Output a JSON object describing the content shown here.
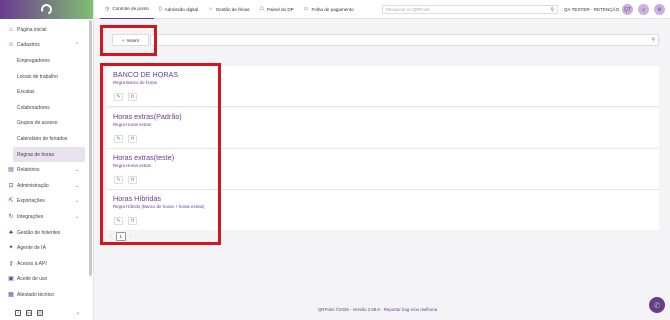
{
  "sidebar": {
    "items": [
      {
        "label": "Página inicial",
        "icon": "home-icon",
        "glyph": "⌂",
        "sub": false,
        "chevron": false
      },
      {
        "label": "Cadastros",
        "icon": "people-icon",
        "glyph": "☺",
        "sub": false,
        "chevron": "up"
      },
      {
        "label": "Empregadores",
        "sub": true
      },
      {
        "label": "Locais de trabalho",
        "sub": true
      },
      {
        "label": "Escalas",
        "sub": true
      },
      {
        "label": "Colaboradores",
        "sub": true
      },
      {
        "label": "Grupos de acesso",
        "sub": true
      },
      {
        "label": "Calendário de feriados",
        "sub": true
      },
      {
        "label": "Regras de horas",
        "sub": true,
        "active": true
      },
      {
        "label": "Relatórios",
        "icon": "file-icon",
        "glyph": "▤",
        "sub": false,
        "chevron": "down"
      },
      {
        "label": "Administração",
        "icon": "lock-icon",
        "glyph": "⊡",
        "sub": false,
        "chevron": "down"
      },
      {
        "label": "Exportações",
        "icon": "export-icon",
        "glyph": "⇱",
        "sub": false,
        "chevron": "down"
      },
      {
        "label": "Integrações",
        "icon": "sync-icon",
        "glyph": "↻",
        "sub": false,
        "chevron": "down"
      },
      {
        "label": "Gestão de holerites",
        "icon": "hierarchy-icon",
        "glyph": "♣",
        "sub": false,
        "chevron": false
      },
      {
        "label": "Agente de IA",
        "icon": "ai-icon",
        "glyph": "✦",
        "sub": false,
        "chevron": false
      },
      {
        "label": "Acesso à API",
        "icon": "key-icon",
        "glyph": "⚷",
        "sub": false,
        "chevron": false
      },
      {
        "label": "Aceite de uso",
        "icon": "document-icon",
        "glyph": "▣",
        "sub": false,
        "chevron": false
      },
      {
        "label": "Atestado técnico",
        "icon": "certificate-icon",
        "glyph": "▦",
        "sub": false,
        "chevron": false
      }
    ],
    "footer_icons": [
      "facebook-icon",
      "linkedin-icon",
      "instagram-icon"
    ],
    "collapse_glyph": "‹"
  },
  "topbar": {
    "tabs": [
      {
        "label": "Controle de ponto",
        "icon": "clock-icon",
        "glyph": "◷",
        "active": true
      },
      {
        "label": "Admissão digital",
        "icon": "document-icon",
        "glyph": "▯",
        "active": false
      },
      {
        "label": "Gestão de férias",
        "icon": "sun-icon",
        "glyph": "☼",
        "active": false
      },
      {
        "label": "Painel do DP",
        "icon": "panel-icon",
        "glyph": "☖",
        "active": false
      },
      {
        "label": "Folha de pagamento",
        "icon": "calendar-icon",
        "glyph": "▭",
        "active": false
      }
    ],
    "search_placeholder": "Pesquisar no QRPoint",
    "user_label": "QA TESTER - RETENÇÃO",
    "avatar_initials": "QT"
  },
  "main": {
    "insert_label": "Inserir",
    "cards": [
      {
        "title": "BANCO DE HORAS",
        "subtitle": "Regra Banco de horas"
      },
      {
        "title": "Horas extras(Padrão)",
        "subtitle": "Regra Horas extras"
      },
      {
        "title": "Horas extras(teste)",
        "subtitle": "Regra Horas extras"
      },
      {
        "title": "Horas Híbridas",
        "subtitle": "Regra Híbrido (Banco de horas + horas extras)"
      }
    ],
    "pagination": {
      "prev": "‹",
      "current": "1",
      "next": "›"
    }
  },
  "footer": {
    "text": "QRPoint ©2026 - Versão 2.98.6 - ",
    "link": "Reportar bug e/ou melhoria"
  },
  "colors": {
    "accent": "#6a3a8f",
    "highlight": "#d4151d",
    "edit": "#3aa84a",
    "delete": "#d23a3a"
  }
}
